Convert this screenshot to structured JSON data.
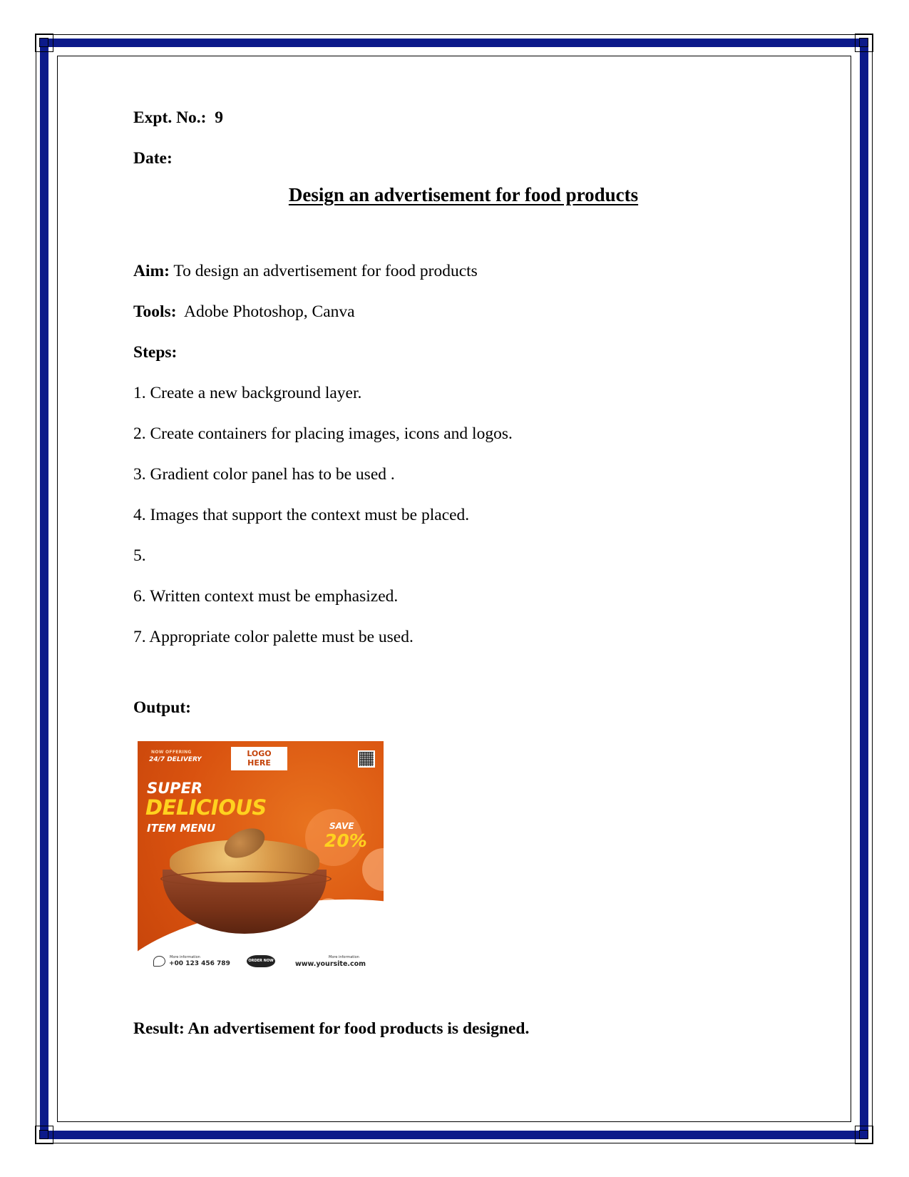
{
  "header": {
    "expt_label": "Expt. No.:",
    "expt_no": "9",
    "date_label": "Date:"
  },
  "title": "Design an advertisement for food products",
  "aim": {
    "label": "Aim:",
    "text": "To design an advertisement for food products"
  },
  "tools": {
    "label": "Tools:",
    "text": "Adobe Photoshop, Canva"
  },
  "steps": {
    "label": "Steps:",
    "items": [
      "1. Create a new background layer.",
      "2. Create containers for placing images, icons and logos.",
      "3. Gradient color panel has to be used .",
      "4. Images that support the context must be placed.",
      "5.",
      "6. Written context must be emphasized.",
      "7. Appropriate color palette must be used."
    ]
  },
  "output_label": "Output:",
  "ad": {
    "now_offering": "NOW OFFERING",
    "delivery": "24/7 DELIVERY",
    "logo_line1": "LOGO",
    "logo_line2": "HERE",
    "super": "SUPER",
    "delicious": "DELICIOUS",
    "item_menu": "ITEM MENU",
    "save": "SAVE",
    "percent": "20%",
    "more_info_left": "More information",
    "phone": "+00 123 456 789",
    "order_now": "ORDER NOW",
    "more_info_right": "More information",
    "website": "www.yoursite.com",
    "colors": {
      "background": "#d9520f",
      "accent": "#ffd21f"
    }
  },
  "result": "Result: An advertisement for food products is designed.",
  "colors": {
    "border": "#0c1a8a"
  }
}
